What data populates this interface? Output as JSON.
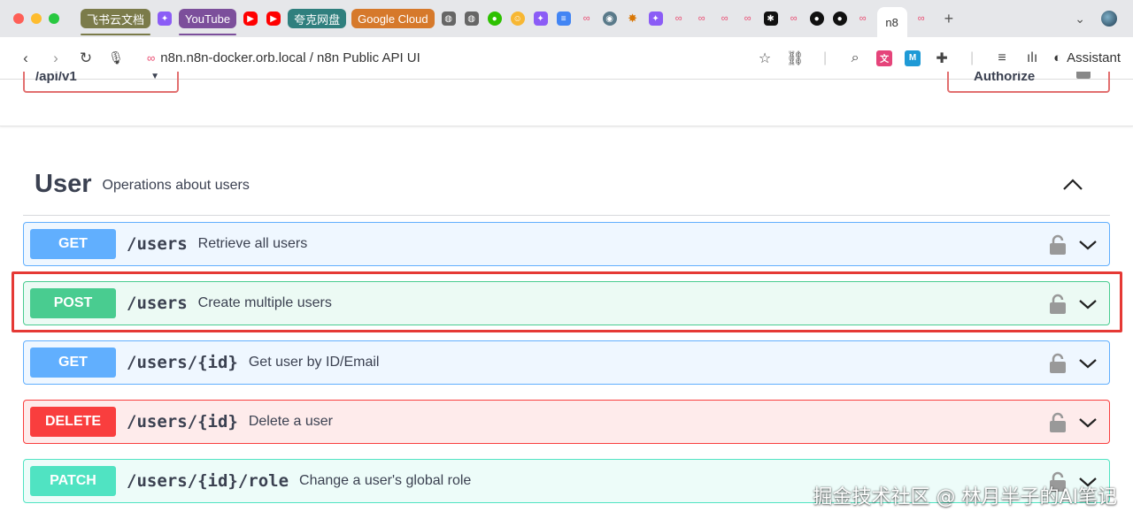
{
  "browser": {
    "tabs_text": [
      {
        "label": "飞书云文档",
        "color": "#7b7b4a",
        "uline": "#7b7b4a"
      },
      {
        "label": "YouTube",
        "color": "#7c4f9b",
        "uline": "#7c4f9b"
      },
      {
        "label": "夸克网盘",
        "color": "#2f7f7e",
        "uline": ""
      },
      {
        "label": "Google Cloud",
        "color": "#d6792b",
        "uline": ""
      }
    ],
    "active_tab_label": "n8",
    "new_tab_label": "+",
    "url": "n8n.n8n-docker.orb.local / n8n Public API UI",
    "assistant_label": "Assistant"
  },
  "page": {
    "server_select_value": "/api/v1",
    "authorize_label": "Authorize",
    "tag": {
      "title": "User",
      "description": "Operations about users"
    },
    "operations": [
      {
        "method": "GET",
        "path": "/users",
        "summary": "Retrieve all users",
        "kind": "get"
      },
      {
        "method": "POST",
        "path": "/users",
        "summary": "Create multiple users",
        "kind": "post"
      },
      {
        "method": "GET",
        "path": "/users/{id}",
        "summary": "Get user by ID/Email",
        "kind": "get"
      },
      {
        "method": "DELETE",
        "path": "/users/{id}",
        "summary": "Delete a user",
        "kind": "delete"
      },
      {
        "method": "PATCH",
        "path": "/users/{id}/role",
        "summary": "Change a user's global role",
        "kind": "patch"
      }
    ]
  },
  "watermark": "掘金技术社区 @ 林月半子的AI笔记",
  "colors": {
    "get": "#61affe",
    "post": "#49cc90",
    "delete": "#f93e3e",
    "patch": "#50e3c2",
    "highlight": "#e53935"
  }
}
